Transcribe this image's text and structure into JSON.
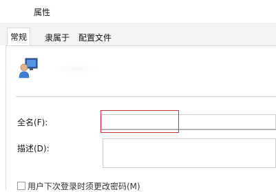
{
  "window": {
    "title": "属性"
  },
  "tabs": [
    {
      "label": "常规",
      "active": true
    },
    {
      "label": "隶属于",
      "active": false
    },
    {
      "label": "配置文件",
      "active": false
    }
  ],
  "general": {
    "icon": "user-account-icon",
    "fullname_label": "全名(F):",
    "fullname_value": "",
    "description_label": "描述(D):",
    "description_value": "",
    "change_password_checkbox_label": "用户下次登录时须更改密码(M)",
    "change_password_checked": false
  },
  "colors": {
    "highlight": "#cc3333"
  }
}
